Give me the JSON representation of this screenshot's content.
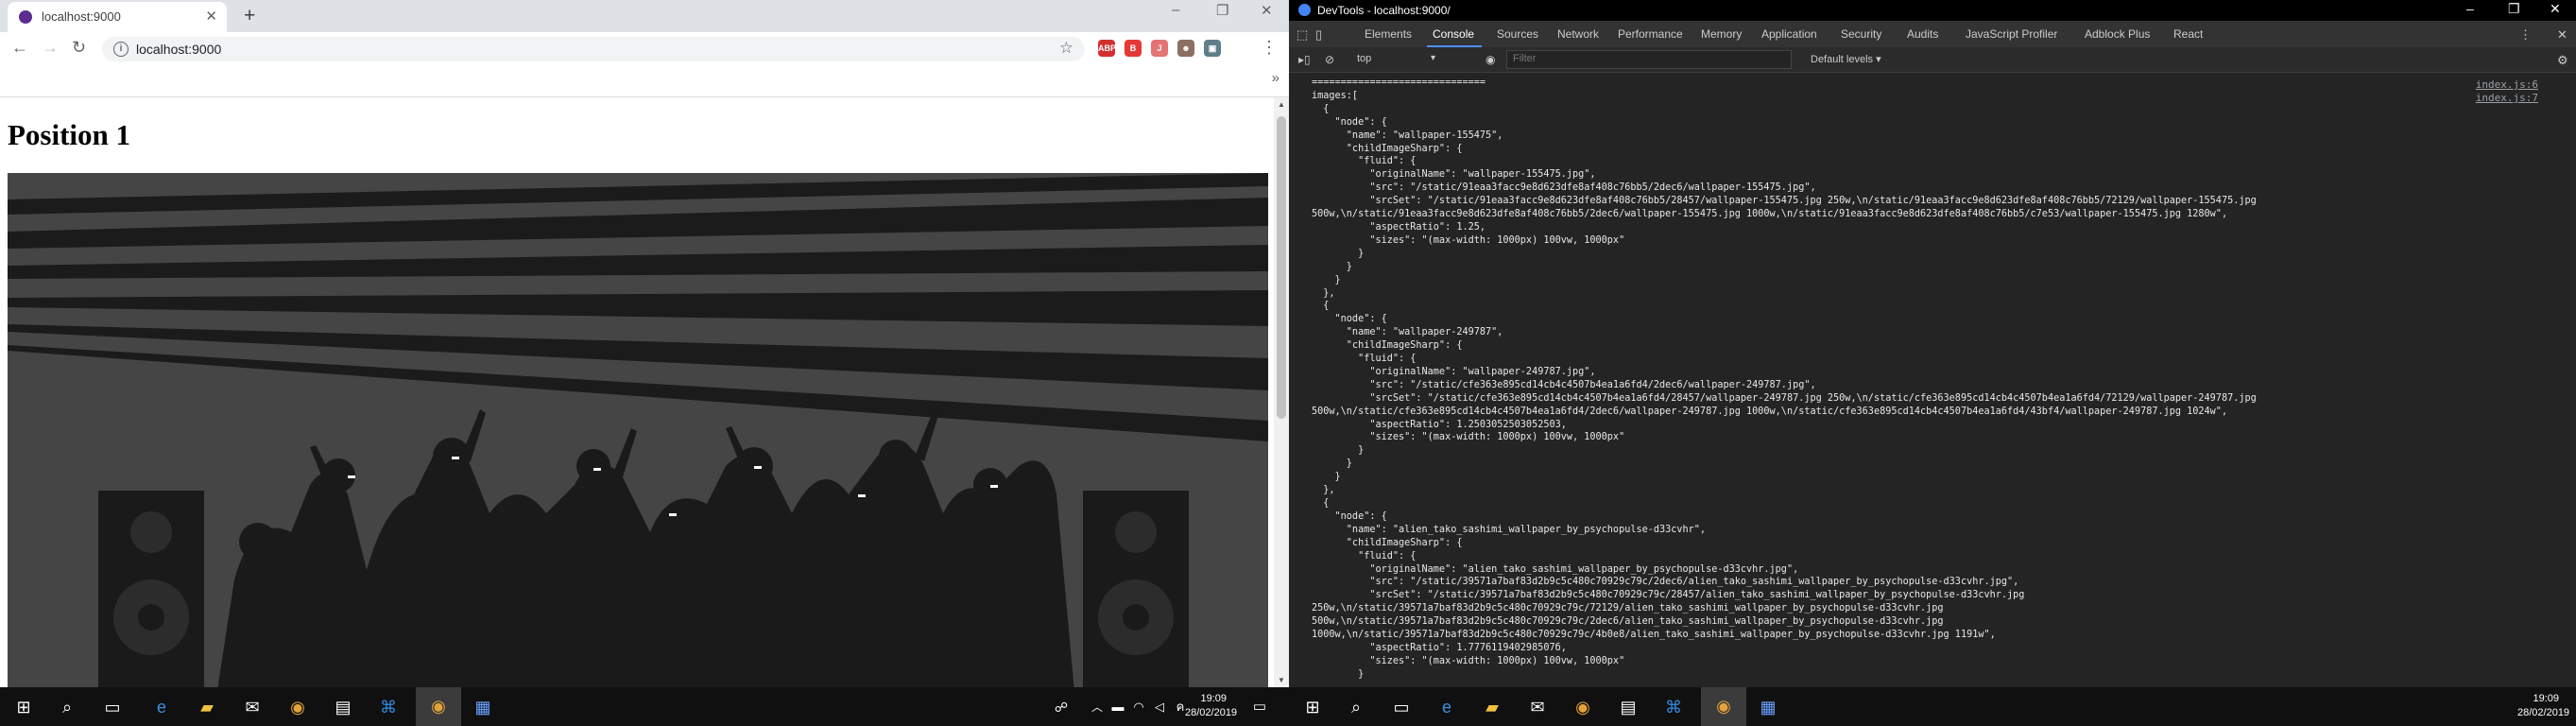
{
  "browser": {
    "tab_title": "localhost:9000",
    "new_tab_glyph": "+",
    "url": "localhost:9000",
    "window_controls": [
      "–",
      "❐",
      "✕"
    ],
    "extensions": [
      {
        "label": "ABP",
        "color": "#d32f2f"
      },
      {
        "label": "B",
        "color": "#e53935"
      },
      {
        "label": "J",
        "color": "#e57373"
      },
      {
        "label": "☻",
        "color": "#8d6e63"
      },
      {
        "label": "▣",
        "color": "#607d8b"
      }
    ]
  },
  "page": {
    "heading": "Position 1"
  },
  "devtools": {
    "title": "DevTools - localhost:9000/",
    "tabs": [
      "Elements",
      "Console",
      "Sources",
      "Network",
      "Performance",
      "Memory",
      "Application",
      "Security",
      "Audits",
      "JavaScript Profiler",
      "Adblock Plus",
      "React"
    ],
    "active_tab": "Console",
    "context": "top",
    "filter_placeholder": "Filter",
    "levels": "Default levels ▾",
    "sources": [
      "index.js:6",
      "index.js:7"
    ],
    "lines": [
      "==============================",
      "images:[",
      "  {",
      "    \"node\": {",
      "      \"name\": \"wallpaper-155475\",",
      "      \"childImageSharp\": {",
      "        \"fluid\": {",
      "          \"originalName\": \"wallpaper-155475.jpg\",",
      "          \"src\": \"/static/91eaa3facc9e8d623dfe8af408c76bb5/2dec6/wallpaper-155475.jpg\",",
      "          \"srcSet\": \"/static/91eaa3facc9e8d623dfe8af408c76bb5/28457/wallpaper-155475.jpg 250w,\\n/static/91eaa3facc9e8d623dfe8af408c76bb5/72129/wallpaper-155475.jpg",
      "500w,\\n/static/91eaa3facc9e8d623dfe8af408c76bb5/2dec6/wallpaper-155475.jpg 1000w,\\n/static/91eaa3facc9e8d623dfe8af408c76bb5/c7e53/wallpaper-155475.jpg 1280w\",",
      "          \"aspectRatio\": 1.25,",
      "          \"sizes\": \"(max-width: 1000px) 100vw, 1000px\"",
      "        }",
      "      }",
      "    }",
      "  },",
      "  {",
      "    \"node\": {",
      "      \"name\": \"wallpaper-249787\",",
      "      \"childImageSharp\": {",
      "        \"fluid\": {",
      "          \"originalName\": \"wallpaper-249787.jpg\",",
      "          \"src\": \"/static/cfe363e895cd14cb4c4507b4ea1a6fd4/2dec6/wallpaper-249787.jpg\",",
      "          \"srcSet\": \"/static/cfe363e895cd14cb4c4507b4ea1a6fd4/28457/wallpaper-249787.jpg 250w,\\n/static/cfe363e895cd14cb4c4507b4ea1a6fd4/72129/wallpaper-249787.jpg",
      "500w,\\n/static/cfe363e895cd14cb4c4507b4ea1a6fd4/2dec6/wallpaper-249787.jpg 1000w,\\n/static/cfe363e895cd14cb4c4507b4ea1a6fd4/43bf4/wallpaper-249787.jpg 1024w\",",
      "          \"aspectRatio\": 1.2503052503052503,",
      "          \"sizes\": \"(max-width: 1000px) 100vw, 1000px\"",
      "        }",
      "      }",
      "    }",
      "  },",
      "  {",
      "    \"node\": {",
      "      \"name\": \"alien_tako_sashimi_wallpaper_by_psychopulse-d33cvhr\",",
      "      \"childImageSharp\": {",
      "        \"fluid\": {",
      "          \"originalName\": \"alien_tako_sashimi_wallpaper_by_psychopulse-d33cvhr.jpg\",",
      "          \"src\": \"/static/39571a7baf83d2b9c5c480c70929c79c/2dec6/alien_tako_sashimi_wallpaper_by_psychopulse-d33cvhr.jpg\",",
      "          \"srcSet\": \"/static/39571a7baf83d2b9c5c480c70929c79c/28457/alien_tako_sashimi_wallpaper_by_psychopulse-d33cvhr.jpg",
      "250w,\\n/static/39571a7baf83d2b9c5c480c70929c79c/72129/alien_tako_sashimi_wallpaper_by_psychopulse-d33cvhr.jpg",
      "500w,\\n/static/39571a7baf83d2b9c5c480c70929c79c/2dec6/alien_tako_sashimi_wallpaper_by_psychopulse-d33cvhr.jpg",
      "1000w,\\n/static/39571a7baf83d2b9c5c480c70929c79c/4b0e8/alien_tako_sashimi_wallpaper_by_psychopulse-d33cvhr.jpg 1191w\",",
      "          \"aspectRatio\": 1.777611940298507б,",
      "          \"sizes\": \"(max-width: 1000px) 100vw, 1000px\"",
      "        }"
    ]
  },
  "taskbar": {
    "left_time": "19:09",
    "left_date": "28/02/2019",
    "right_time": "19:09",
    "right_date": "28/02/2019"
  },
  "colors": {
    "devtools_bg": "#242424",
    "tab_accent": "#4d90fe",
    "hero_bg": "#454545",
    "silhouette": "#1a1a1a"
  }
}
